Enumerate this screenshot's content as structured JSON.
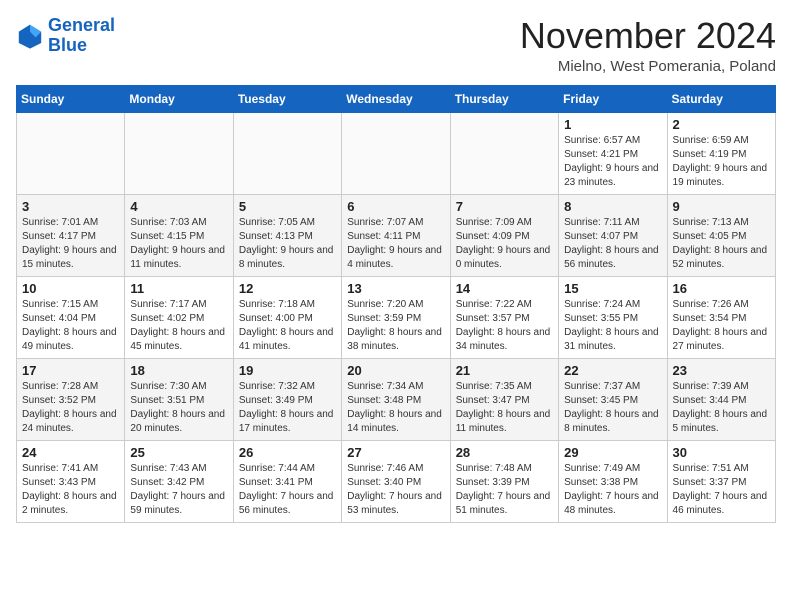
{
  "logo": {
    "line1": "General",
    "line2": "Blue"
  },
  "title": "November 2024",
  "subtitle": "Mielno, West Pomerania, Poland",
  "days_of_week": [
    "Sunday",
    "Monday",
    "Tuesday",
    "Wednesday",
    "Thursday",
    "Friday",
    "Saturday"
  ],
  "weeks": [
    [
      {
        "day": "",
        "sunrise": "",
        "sunset": "",
        "daylight": "",
        "empty": true
      },
      {
        "day": "",
        "sunrise": "",
        "sunset": "",
        "daylight": "",
        "empty": true
      },
      {
        "day": "",
        "sunrise": "",
        "sunset": "",
        "daylight": "",
        "empty": true
      },
      {
        "day": "",
        "sunrise": "",
        "sunset": "",
        "daylight": "",
        "empty": true
      },
      {
        "day": "",
        "sunrise": "",
        "sunset": "",
        "daylight": "",
        "empty": true
      },
      {
        "day": "1",
        "sunrise": "Sunrise: 6:57 AM",
        "sunset": "Sunset: 4:21 PM",
        "daylight": "Daylight: 9 hours and 23 minutes.",
        "empty": false
      },
      {
        "day": "2",
        "sunrise": "Sunrise: 6:59 AM",
        "sunset": "Sunset: 4:19 PM",
        "daylight": "Daylight: 9 hours and 19 minutes.",
        "empty": false
      }
    ],
    [
      {
        "day": "3",
        "sunrise": "Sunrise: 7:01 AM",
        "sunset": "Sunset: 4:17 PM",
        "daylight": "Daylight: 9 hours and 15 minutes.",
        "empty": false
      },
      {
        "day": "4",
        "sunrise": "Sunrise: 7:03 AM",
        "sunset": "Sunset: 4:15 PM",
        "daylight": "Daylight: 9 hours and 11 minutes.",
        "empty": false
      },
      {
        "day": "5",
        "sunrise": "Sunrise: 7:05 AM",
        "sunset": "Sunset: 4:13 PM",
        "daylight": "Daylight: 9 hours and 8 minutes.",
        "empty": false
      },
      {
        "day": "6",
        "sunrise": "Sunrise: 7:07 AM",
        "sunset": "Sunset: 4:11 PM",
        "daylight": "Daylight: 9 hours and 4 minutes.",
        "empty": false
      },
      {
        "day": "7",
        "sunrise": "Sunrise: 7:09 AM",
        "sunset": "Sunset: 4:09 PM",
        "daylight": "Daylight: 9 hours and 0 minutes.",
        "empty": false
      },
      {
        "day": "8",
        "sunrise": "Sunrise: 7:11 AM",
        "sunset": "Sunset: 4:07 PM",
        "daylight": "Daylight: 8 hours and 56 minutes.",
        "empty": false
      },
      {
        "day": "9",
        "sunrise": "Sunrise: 7:13 AM",
        "sunset": "Sunset: 4:05 PM",
        "daylight": "Daylight: 8 hours and 52 minutes.",
        "empty": false
      }
    ],
    [
      {
        "day": "10",
        "sunrise": "Sunrise: 7:15 AM",
        "sunset": "Sunset: 4:04 PM",
        "daylight": "Daylight: 8 hours and 49 minutes.",
        "empty": false
      },
      {
        "day": "11",
        "sunrise": "Sunrise: 7:17 AM",
        "sunset": "Sunset: 4:02 PM",
        "daylight": "Daylight: 8 hours and 45 minutes.",
        "empty": false
      },
      {
        "day": "12",
        "sunrise": "Sunrise: 7:18 AM",
        "sunset": "Sunset: 4:00 PM",
        "daylight": "Daylight: 8 hours and 41 minutes.",
        "empty": false
      },
      {
        "day": "13",
        "sunrise": "Sunrise: 7:20 AM",
        "sunset": "Sunset: 3:59 PM",
        "daylight": "Daylight: 8 hours and 38 minutes.",
        "empty": false
      },
      {
        "day": "14",
        "sunrise": "Sunrise: 7:22 AM",
        "sunset": "Sunset: 3:57 PM",
        "daylight": "Daylight: 8 hours and 34 minutes.",
        "empty": false
      },
      {
        "day": "15",
        "sunrise": "Sunrise: 7:24 AM",
        "sunset": "Sunset: 3:55 PM",
        "daylight": "Daylight: 8 hours and 31 minutes.",
        "empty": false
      },
      {
        "day": "16",
        "sunrise": "Sunrise: 7:26 AM",
        "sunset": "Sunset: 3:54 PM",
        "daylight": "Daylight: 8 hours and 27 minutes.",
        "empty": false
      }
    ],
    [
      {
        "day": "17",
        "sunrise": "Sunrise: 7:28 AM",
        "sunset": "Sunset: 3:52 PM",
        "daylight": "Daylight: 8 hours and 24 minutes.",
        "empty": false
      },
      {
        "day": "18",
        "sunrise": "Sunrise: 7:30 AM",
        "sunset": "Sunset: 3:51 PM",
        "daylight": "Daylight: 8 hours and 20 minutes.",
        "empty": false
      },
      {
        "day": "19",
        "sunrise": "Sunrise: 7:32 AM",
        "sunset": "Sunset: 3:49 PM",
        "daylight": "Daylight: 8 hours and 17 minutes.",
        "empty": false
      },
      {
        "day": "20",
        "sunrise": "Sunrise: 7:34 AM",
        "sunset": "Sunset: 3:48 PM",
        "daylight": "Daylight: 8 hours and 14 minutes.",
        "empty": false
      },
      {
        "day": "21",
        "sunrise": "Sunrise: 7:35 AM",
        "sunset": "Sunset: 3:47 PM",
        "daylight": "Daylight: 8 hours and 11 minutes.",
        "empty": false
      },
      {
        "day": "22",
        "sunrise": "Sunrise: 7:37 AM",
        "sunset": "Sunset: 3:45 PM",
        "daylight": "Daylight: 8 hours and 8 minutes.",
        "empty": false
      },
      {
        "day": "23",
        "sunrise": "Sunrise: 7:39 AM",
        "sunset": "Sunset: 3:44 PM",
        "daylight": "Daylight: 8 hours and 5 minutes.",
        "empty": false
      }
    ],
    [
      {
        "day": "24",
        "sunrise": "Sunrise: 7:41 AM",
        "sunset": "Sunset: 3:43 PM",
        "daylight": "Daylight: 8 hours and 2 minutes.",
        "empty": false
      },
      {
        "day": "25",
        "sunrise": "Sunrise: 7:43 AM",
        "sunset": "Sunset: 3:42 PM",
        "daylight": "Daylight: 7 hours and 59 minutes.",
        "empty": false
      },
      {
        "day": "26",
        "sunrise": "Sunrise: 7:44 AM",
        "sunset": "Sunset: 3:41 PM",
        "daylight": "Daylight: 7 hours and 56 minutes.",
        "empty": false
      },
      {
        "day": "27",
        "sunrise": "Sunrise: 7:46 AM",
        "sunset": "Sunset: 3:40 PM",
        "daylight": "Daylight: 7 hours and 53 minutes.",
        "empty": false
      },
      {
        "day": "28",
        "sunrise": "Sunrise: 7:48 AM",
        "sunset": "Sunset: 3:39 PM",
        "daylight": "Daylight: 7 hours and 51 minutes.",
        "empty": false
      },
      {
        "day": "29",
        "sunrise": "Sunrise: 7:49 AM",
        "sunset": "Sunset: 3:38 PM",
        "daylight": "Daylight: 7 hours and 48 minutes.",
        "empty": false
      },
      {
        "day": "30",
        "sunrise": "Sunrise: 7:51 AM",
        "sunset": "Sunset: 3:37 PM",
        "daylight": "Daylight: 7 hours and 46 minutes.",
        "empty": false
      }
    ]
  ],
  "row_classes": [
    "row-odd",
    "row-even",
    "row-odd",
    "row-even",
    "row-odd"
  ]
}
